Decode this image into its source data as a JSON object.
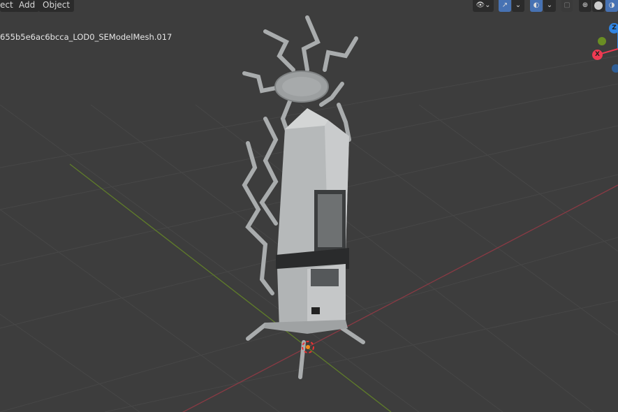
{
  "header": {
    "menus": [
      "ect",
      "Add",
      "Object"
    ]
  },
  "viewport": {
    "object_name": "655b5e6ac6bcca_LOD0_SEModelMesh.017"
  },
  "toolbar": {
    "icons": [
      "visibility-icon",
      "gizmo-icon",
      "overlay-icon",
      "xray-icon",
      "wireframe-shading-icon",
      "solid-shading-icon",
      "material-shading-icon"
    ]
  },
  "gizmo": {
    "z_label": "Z",
    "x_label": "X",
    "colors": {
      "x": "#f03a52",
      "y": "#6a8e23",
      "z": "#2f84e3"
    }
  }
}
